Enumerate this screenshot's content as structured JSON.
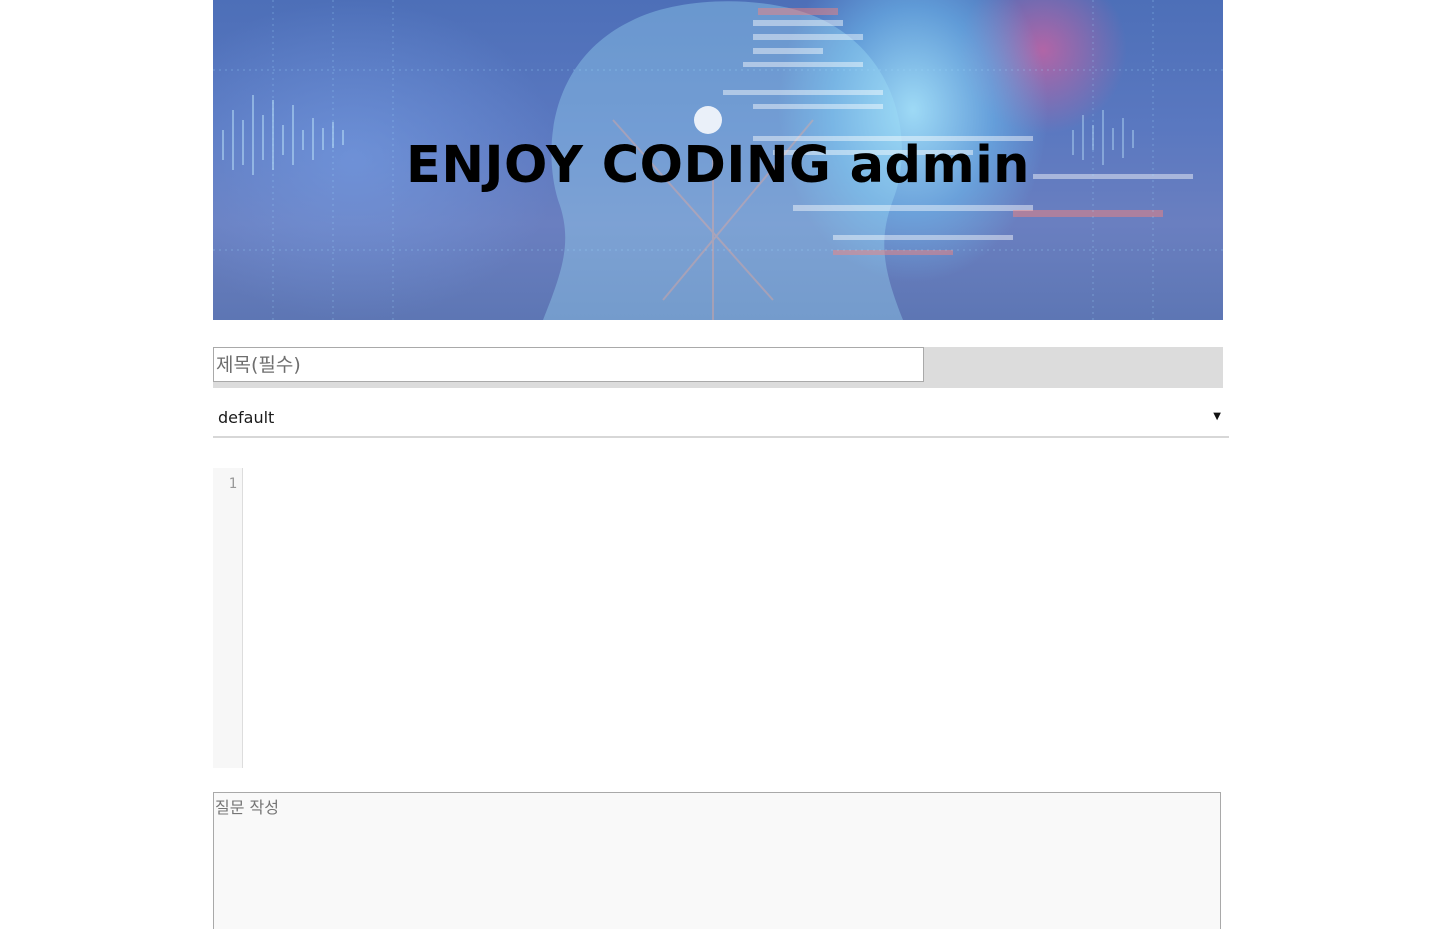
{
  "header": {
    "title": "ENJOY CODING admin"
  },
  "form": {
    "title_placeholder": "제목(필수)",
    "language_select": {
      "selected": "default"
    },
    "editor": {
      "line_numbers": [
        "1"
      ]
    },
    "question_placeholder": "질문 작성"
  },
  "colors": {
    "title_row_background": "#dcdcdc",
    "gutter_background": "#f7f7f7",
    "textarea_background": "#f9f9f9",
    "banner_base": "#5a78c0"
  },
  "icons": {
    "select_arrow": "caret-down-icon"
  }
}
